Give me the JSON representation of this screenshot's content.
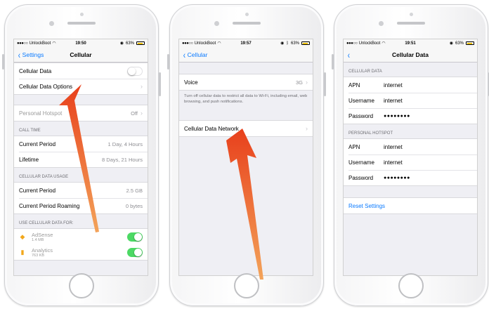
{
  "status": {
    "carrier": "UnlockBoot",
    "battery": "63%",
    "times": [
      "19:50",
      "19:57",
      "19:51"
    ]
  },
  "screen1": {
    "back": "Settings",
    "title": "Cellular",
    "rows_top": [
      {
        "label": "Cellular Data"
      },
      {
        "label": "Cellular Data Options"
      }
    ],
    "hotspot": {
      "label": "Personal Hotspot",
      "value": "Off"
    },
    "call_time": {
      "header": "CALL TIME",
      "rows": [
        {
          "label": "Current Period",
          "value": "1 Day, 4 Hours"
        },
        {
          "label": "Lifetime",
          "value": "8 Days, 21 Hours"
        }
      ]
    },
    "usage": {
      "header": "CELLULAR DATA USAGE",
      "rows": [
        {
          "label": "Current Period",
          "value": "2.5 GB"
        },
        {
          "label": "Current Period Roaming",
          "value": "0 bytes"
        }
      ]
    },
    "use_for": {
      "header": "USE CELLULAR DATA FOR:",
      "apps": [
        {
          "name": "AdSense",
          "size": "1.4 MB"
        },
        {
          "name": "Analytics",
          "size": "763 KB"
        }
      ]
    }
  },
  "screen2": {
    "back": "Cellular",
    "voice": {
      "label": "Voice",
      "value": "3G"
    },
    "note": "Turn off cellular data to restrict all data to Wi-Fi, including email, web browsing, and push notifications.",
    "network": {
      "label": "Cellular Data Network"
    }
  },
  "screen3": {
    "title": "Cellular Data",
    "cellular": {
      "header": "CELLULAR DATA",
      "rows": [
        {
          "k": "APN",
          "v": "internet"
        },
        {
          "k": "Username",
          "v": "internet"
        },
        {
          "k": "Password",
          "v": "●●●●●●●●"
        }
      ]
    },
    "hotspot": {
      "header": "PERSONAL HOTSPOT",
      "rows": [
        {
          "k": "APN",
          "v": "internet"
        },
        {
          "k": "Username",
          "v": "internet"
        },
        {
          "k": "Password",
          "v": "●●●●●●●●"
        }
      ]
    },
    "reset": "Reset Settings"
  },
  "colors": {
    "accent": "#0a7aff",
    "arrow": "#e8401c",
    "switch_on": "#4cd964"
  }
}
